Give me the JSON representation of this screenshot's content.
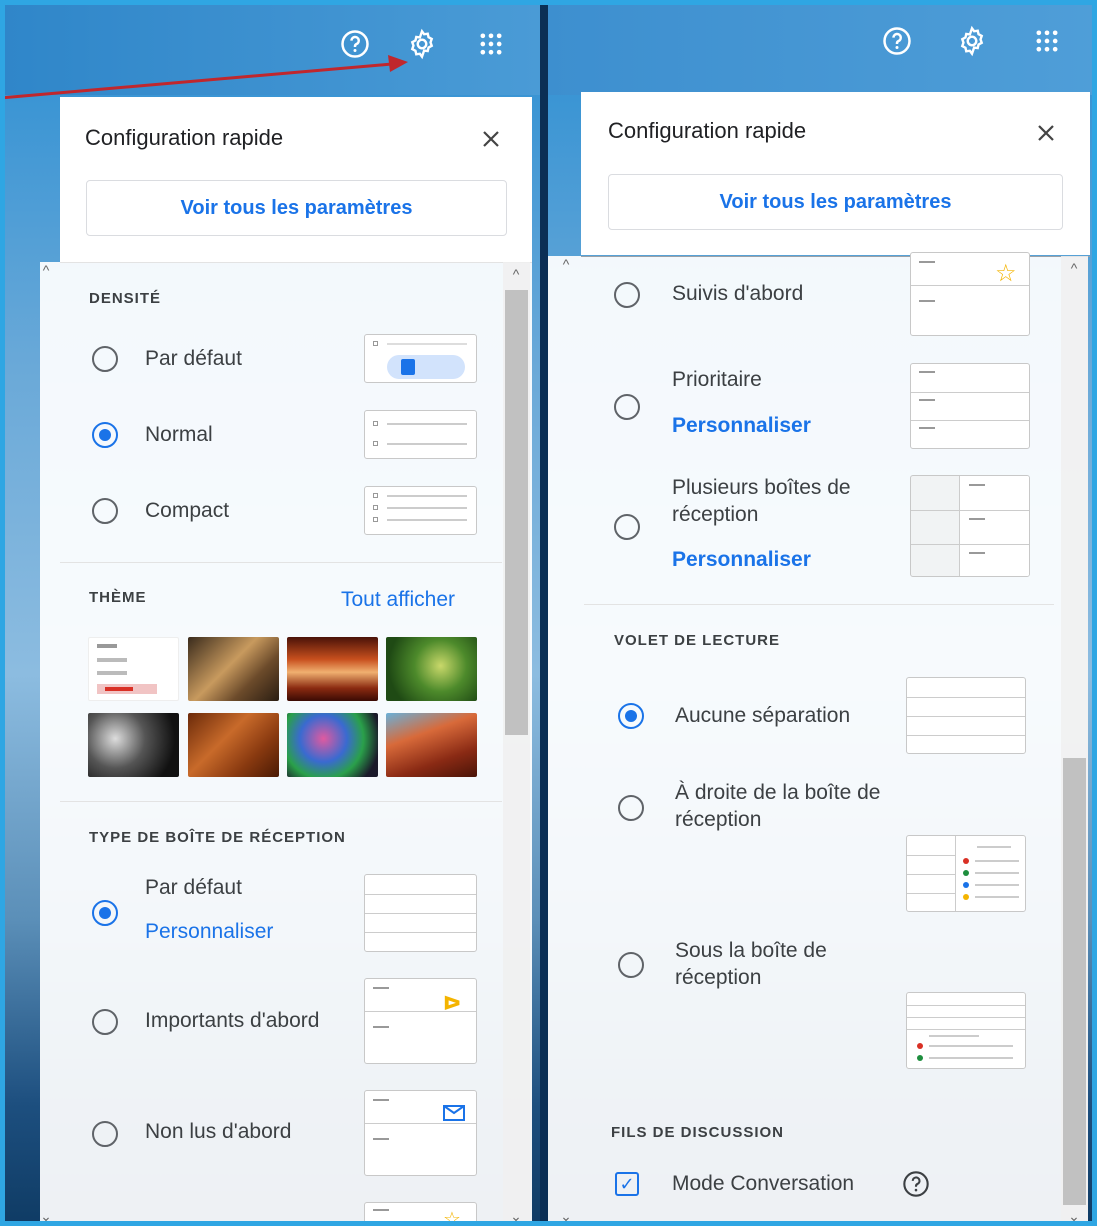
{
  "left_panel": {
    "title": "Configuration rapide",
    "see_all": "Voir tous les paramètres",
    "density": {
      "heading": "DENSITÉ",
      "options": [
        "Par défaut",
        "Normal",
        "Compact"
      ],
      "selected": "Normal"
    },
    "theme": {
      "heading": "THÈME",
      "show_all": "Tout afficher"
    },
    "inbox_type": {
      "heading": "TYPE DE BOÎTE DE RÉCEPTION",
      "options": [
        "Par défaut",
        "Importants d'abord",
        "Non lus d'abord"
      ],
      "customize": "Personnaliser",
      "selected": "Par défaut"
    }
  },
  "right_panel": {
    "title": "Configuration rapide",
    "see_all": "Voir tous les paramètres",
    "inbox_type": {
      "options": [
        "Suivis d'abord",
        "Prioritaire",
        "Plusieurs boîtes de réception"
      ],
      "customize": "Personnaliser"
    },
    "reading_pane": {
      "heading": "VOLET DE LECTURE",
      "options": [
        "Aucune séparation",
        "À droite de la boîte de réception",
        "Sous la boîte de réception"
      ],
      "selected": "Aucune séparation"
    },
    "threading": {
      "heading": "FILS DE DISCUSSION",
      "conversation_mode": "Mode Conversation",
      "checked": true
    }
  },
  "top_icons": [
    "help-icon",
    "settings-icon",
    "apps-icon"
  ],
  "colors": {
    "accent": "#1a73e8",
    "arrow": "#c0272d",
    "star": "#f4b400",
    "important": "#f4b400"
  }
}
